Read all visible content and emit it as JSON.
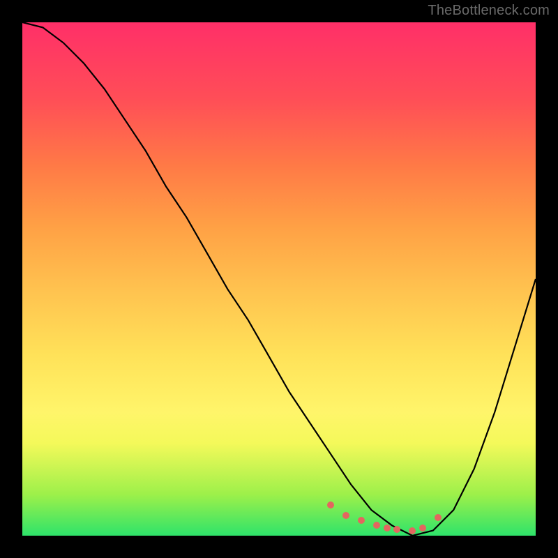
{
  "watermark": "TheBottleneck.com",
  "chart_data": {
    "type": "line",
    "title": "",
    "xlabel": "",
    "ylabel": "",
    "xlim": [
      0,
      100
    ],
    "ylim": [
      0,
      100
    ],
    "background_gradient": {
      "top": "#ff2f68",
      "mid": "#ffe259",
      "bottom": "#2ee36a"
    },
    "series": [
      {
        "name": "bottleneck-curve",
        "x": [
          0,
          4,
          8,
          12,
          16,
          20,
          24,
          28,
          32,
          36,
          40,
          44,
          48,
          52,
          56,
          60,
          64,
          68,
          72,
          76,
          80,
          84,
          88,
          92,
          96,
          100
        ],
        "values": [
          100,
          99,
          96,
          92,
          87,
          81,
          75,
          68,
          62,
          55,
          48,
          42,
          35,
          28,
          22,
          16,
          10,
          5,
          2,
          0,
          1,
          5,
          13,
          24,
          37,
          50
        ]
      }
    ],
    "marker_points": {
      "name": "selected-range-dots",
      "color": "#e4665f",
      "x": [
        60,
        63,
        66,
        69,
        71,
        73,
        76,
        78,
        81
      ],
      "values": [
        6,
        4,
        3,
        2,
        1.5,
        1.2,
        1,
        1.5,
        3.5
      ]
    }
  }
}
